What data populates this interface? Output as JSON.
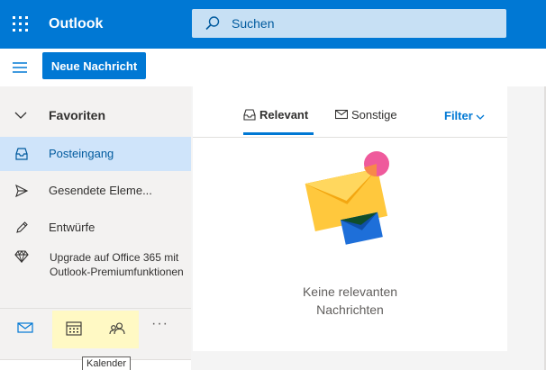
{
  "header": {
    "brand": "Outlook",
    "search_placeholder": "Suchen"
  },
  "command_bar": {
    "new_message_label": "Neue Nachricht"
  },
  "sidebar": {
    "favorites_label": "Favoriten",
    "items": [
      {
        "label": "Posteingang",
        "icon": "inbox-icon",
        "selected": true
      },
      {
        "label": "Gesendete Eleme...",
        "icon": "send-icon",
        "selected": false
      },
      {
        "label": "Entwürfe",
        "icon": "pencil-icon",
        "selected": false
      }
    ],
    "upgrade_text": "Upgrade auf Office 365 mit Outlook-Premiumfunktionen"
  },
  "bottom_bar": {
    "more_label": "···",
    "tooltip": "Kalender"
  },
  "message_list": {
    "tabs": [
      {
        "label": "Relevant",
        "active": true
      },
      {
        "label": "Sonstige",
        "active": false
      }
    ],
    "filter_label": "Filter",
    "empty_line1": "Keine relevanten",
    "empty_line2": "Nachrichten"
  },
  "colors": {
    "brand": "#0078d4",
    "search_bg": "#c7e0f4",
    "selected_bg": "#cfe4fa",
    "highlight": "#fff9c4"
  }
}
